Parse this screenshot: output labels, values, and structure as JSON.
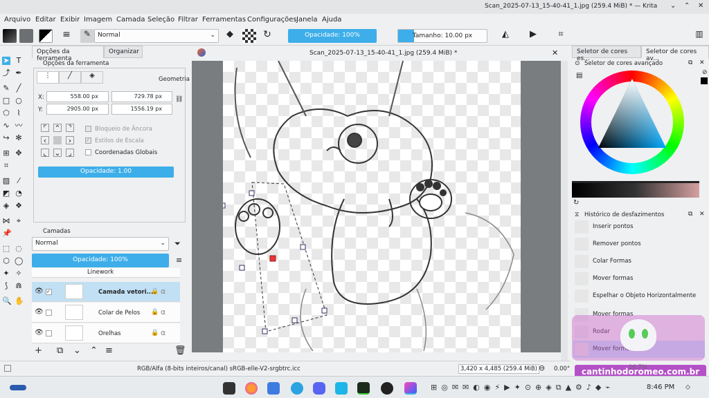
{
  "window": {
    "title": "Scan_2025-07-13_15-40-41_1.jpg (259.4 MiB) * — Krita"
  },
  "menu": [
    "Arquivo",
    "Editar",
    "Exibir",
    "Imagem",
    "Camada",
    "Seleção",
    "Filtrar",
    "Ferramentas",
    "Configurações",
    "Janela",
    "Ajuda"
  ],
  "toolbar": {
    "blend_mode": "Normal",
    "opacity": "Opacidade: 100%",
    "size": "Tamanho: 10.00 px"
  },
  "tool_options": {
    "tabs": [
      "Opções da ferramenta",
      "Organizar"
    ],
    "title": "Opções da ferramenta",
    "geometry": "Geometria",
    "x_label": "X:",
    "y_label": "Y:",
    "x": "558.00 px",
    "y": "2905.00 px",
    "w": "729.78 px",
    "h": "1556.19 px",
    "anchor_lock": "Bloqueio de Âncora",
    "scale_styles": "Estilos de Escala",
    "global_coords": "Coordenadas Globais",
    "opacity": "Opacidade: 1.00"
  },
  "canvas": {
    "tab_title": "Scan_2025-07-13_15-40-41_1.jpg (259.4 MiB) *"
  },
  "layers": {
    "title": "Camadas",
    "blend": "Normal",
    "opacity": "Opacidade:  100%",
    "items": [
      {
        "name": "Linework"
      },
      {
        "name": "Camada vetori..."
      },
      {
        "name": "Colar de Pelos"
      },
      {
        "name": "Orelhas"
      }
    ]
  },
  "color": {
    "tabs": [
      "Seletor de cores es...",
      "Seletor de cores av..."
    ],
    "title": "Seletor de cores avançado"
  },
  "history": {
    "title": "Histórico de desfazimentos",
    "items": [
      "Inserir pontos",
      "Remover pontos",
      "Colar Formas",
      "Mover formas",
      "Espelhar o Objeto Horizontalmente",
      "Mover formas",
      "Rodar",
      "Mover formas"
    ]
  },
  "status": {
    "color_space": "RGB/Alfa (8-bits inteiros/canal)  sRGB-elle-V2-srgbtrc.icc",
    "dims": "3,420 x 4,485 (259.4 MiB)",
    "rotation": "0.00°",
    "zoom": "16.7%"
  },
  "taskbar": {
    "time": "8:46 PM"
  },
  "watermark": {
    "text": "cantinhodoromeo.com.br"
  }
}
